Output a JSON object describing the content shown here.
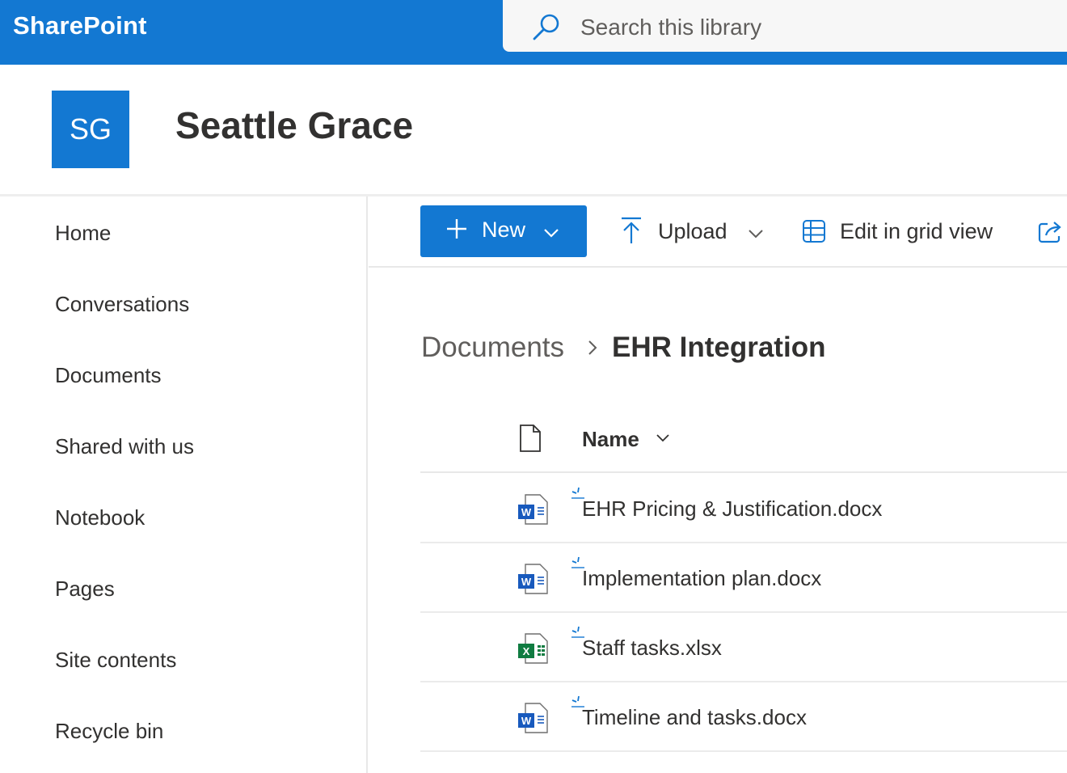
{
  "app": {
    "name": "SharePoint"
  },
  "search": {
    "placeholder": "Search this library"
  },
  "site": {
    "logo_text": "SG",
    "title": "Seattle Grace"
  },
  "nav": {
    "items": [
      {
        "label": "Home"
      },
      {
        "label": "Conversations"
      },
      {
        "label": "Documents"
      },
      {
        "label": "Shared with us"
      },
      {
        "label": "Notebook"
      },
      {
        "label": "Pages"
      },
      {
        "label": "Site contents"
      },
      {
        "label": "Recycle bin"
      }
    ]
  },
  "toolbar": {
    "new_label": "New",
    "upload_label": "Upload",
    "grid_label": "Edit in grid view"
  },
  "breadcrumb": {
    "root": "Documents",
    "current": "EHR Integration"
  },
  "list": {
    "name_header": "Name",
    "files": [
      {
        "name": "EHR Pricing & Justification.docx",
        "type": "word"
      },
      {
        "name": "Implementation plan.docx",
        "type": "word"
      },
      {
        "name": "Staff tasks.xlsx",
        "type": "excel"
      },
      {
        "name": "Timeline and tasks.docx",
        "type": "word"
      }
    ]
  },
  "colors": {
    "brand": "#1378d2",
    "word": "#185abd",
    "excel": "#107c41"
  }
}
